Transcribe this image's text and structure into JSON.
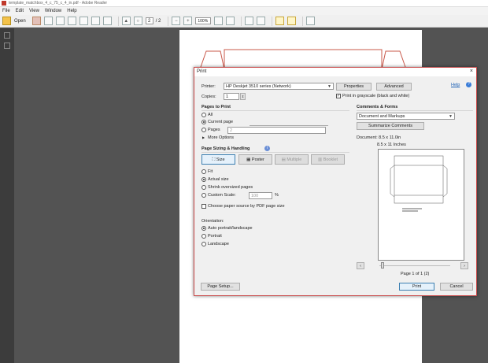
{
  "window": {
    "title": "template_matchbox_4_c_75_c_4_in.pdf - Adobe Reader"
  },
  "menu": [
    "File",
    "Edit",
    "View",
    "Window",
    "Help"
  ],
  "toolbar": {
    "open_label": "Open",
    "page_current": "2",
    "page_total": "/ 2",
    "zoom": "100%"
  },
  "dialog": {
    "title": "Print",
    "close": "×",
    "printer_label": "Printer:",
    "printer_value": "HP Deskjet 3510 series (Network)",
    "properties_btn": "Properties",
    "advanced_btn": "Advanced",
    "help_link": "Help",
    "copies_label": "Copies:",
    "copies_value": "1",
    "grayscale_label": "Print in grayscale (black and white)",
    "pages_heading": "Pages to Print",
    "all_label": "All",
    "current_label": "Current page",
    "pages_label": "Pages",
    "pages_value": "2",
    "more_options": "More Options",
    "sizing_heading": "Page Sizing & Handling",
    "size_btn": "Size",
    "poster_btn": "Poster",
    "multiple_btn": "Multiple",
    "booklet_btn": "Booklet",
    "fit_label": "Fit",
    "actual_label": "Actual size",
    "shrink_label": "Shrink oversized pages",
    "custom_label": "Custom Scale:",
    "custom_value": "100",
    "percent": "%",
    "paper_source_label": "Choose paper source by PDF page size",
    "orientation_heading": "Orientation:",
    "auto_label": "Auto portrait/landscape",
    "portrait_label": "Portrait",
    "landscape_label": "Landscape",
    "comments_heading": "Comments & Forms",
    "comments_value": "Document and Markups",
    "summarize_btn": "Summarize Comments",
    "doc_size": "Document: 8.5 x 11.0in",
    "paper_size": "8.5 x 11 Inches",
    "page_of": "Page 1 of 1 (2)",
    "prev": "‹",
    "next": "›",
    "page_setup_btn": "Page Setup...",
    "print_btn": "Print",
    "cancel_btn": "Cancel"
  }
}
